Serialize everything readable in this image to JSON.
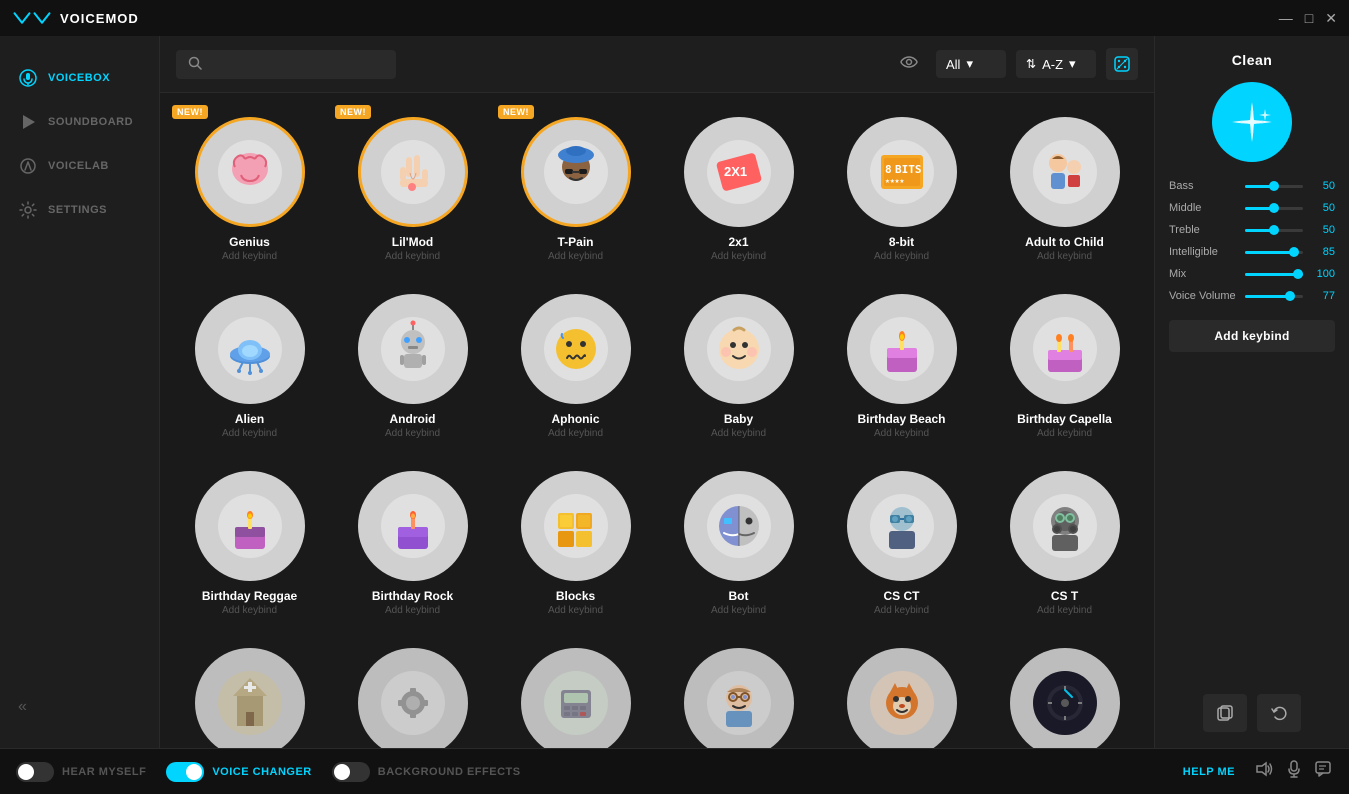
{
  "app": {
    "title": "VOICEMOD",
    "logo_unicode": "〜"
  },
  "title_bar": {
    "minimize": "—",
    "maximize": "□",
    "close": "✕"
  },
  "sidebar": {
    "items": [
      {
        "id": "voicebox",
        "label": "VOICEBOX",
        "icon": "🎤",
        "active": true
      },
      {
        "id": "soundboard",
        "label": "SOUNDBOARD",
        "icon": "⚡"
      },
      {
        "id": "voicelab",
        "label": "VOICELAB",
        "icon": "🎙"
      },
      {
        "id": "settings",
        "label": "SETTINGS",
        "icon": "⚙"
      }
    ],
    "collapse_icon": "«"
  },
  "toolbar": {
    "search_placeholder": "",
    "search_icon": "🔍",
    "eye_icon": "👁",
    "filter_label": "All",
    "filter_chevron": "▾",
    "sort_icon": "⇅",
    "sort_label": "A-Z",
    "sort_chevron": "▾",
    "dice_icon": "⚄"
  },
  "voices": [
    {
      "id": "genius",
      "name": "Genius",
      "keybind": "Add keybind",
      "badge": "NEW!",
      "emoji": "🧠",
      "bg": "#d8d8d8",
      "highlighted": true
    },
    {
      "id": "lilmod",
      "name": "Lil'Mod",
      "keybind": "Add keybind",
      "badge": "NEW!",
      "emoji": "✌️",
      "bg": "#d8d8d8",
      "highlighted": true
    },
    {
      "id": "tpain",
      "name": "T-Pain",
      "keybind": "Add keybind",
      "badge": "NEW!",
      "emoji": "🎤",
      "bg": "#d8d8d8",
      "highlighted": true
    },
    {
      "id": "2x1",
      "name": "2x1",
      "keybind": "Add keybind",
      "badge": "",
      "emoji": "🏷",
      "bg": "#d8d8d8",
      "highlighted": false
    },
    {
      "id": "8bit",
      "name": "8-bit",
      "keybind": "Add keybind",
      "badge": "",
      "emoji": "8️⃣",
      "bg": "#d8d8d8",
      "highlighted": false
    },
    {
      "id": "adult-to-child",
      "name": "Adult to Child",
      "keybind": "Add keybind",
      "badge": "",
      "emoji": "👨‍👧",
      "bg": "#d8d8d8",
      "highlighted": false
    },
    {
      "id": "alien",
      "name": "Alien",
      "keybind": "Add keybind",
      "badge": "",
      "emoji": "🛸",
      "bg": "#d8d8d8",
      "highlighted": false
    },
    {
      "id": "android",
      "name": "Android",
      "keybind": "Add keybind",
      "badge": "",
      "emoji": "🤖",
      "bg": "#d8d8d8",
      "highlighted": false
    },
    {
      "id": "aphonic",
      "name": "Aphonic",
      "keybind": "Add keybind",
      "badge": "",
      "emoji": "😖",
      "bg": "#d8d8d8",
      "highlighted": false
    },
    {
      "id": "baby",
      "name": "Baby",
      "keybind": "Add keybind",
      "badge": "",
      "emoji": "👶",
      "bg": "#d8d8d8",
      "highlighted": false
    },
    {
      "id": "birthday-beach",
      "name": "Birthday Beach",
      "keybind": "Add keybind",
      "badge": "",
      "emoji": "🎂",
      "bg": "#d8d8d8",
      "highlighted": false
    },
    {
      "id": "birthday-capella",
      "name": "Birthday Capella",
      "keybind": "Add keybind",
      "badge": "",
      "emoji": "🕯",
      "bg": "#d8d8d8",
      "highlighted": false
    },
    {
      "id": "birthday-reggae",
      "name": "Birthday Reggae",
      "keybind": "Add keybind",
      "badge": "",
      "emoji": "🎂",
      "bg": "#d8d8d8",
      "highlighted": false
    },
    {
      "id": "birthday-rock",
      "name": "Birthday Rock",
      "keybind": "Add keybind",
      "badge": "",
      "emoji": "🎂",
      "bg": "#d8d8d8",
      "highlighted": false
    },
    {
      "id": "blocks",
      "name": "Blocks",
      "keybind": "Add keybind",
      "badge": "",
      "emoji": "🟨",
      "bg": "#d8d8d8",
      "highlighted": false
    },
    {
      "id": "bot",
      "name": "Bot",
      "keybind": "Add keybind",
      "badge": "",
      "emoji": "🤖",
      "bg": "#d8d8d8",
      "highlighted": false
    },
    {
      "id": "cs-ct",
      "name": "CS CT",
      "keybind": "Add keybind",
      "badge": "",
      "emoji": "🥽",
      "bg": "#d8d8d8",
      "highlighted": false
    },
    {
      "id": "cs-t",
      "name": "CS T",
      "keybind": "Add keybind",
      "badge": "",
      "emoji": "😷",
      "bg": "#d8d8d8",
      "highlighted": false
    },
    {
      "id": "v19",
      "name": "",
      "keybind": "",
      "badge": "",
      "emoji": "🏛",
      "bg": "#d8d8d8",
      "highlighted": false,
      "partial": true
    },
    {
      "id": "v20",
      "name": "",
      "keybind": "",
      "badge": "",
      "emoji": "⚙",
      "bg": "#d8d8d8",
      "highlighted": false,
      "partial": true
    },
    {
      "id": "v21",
      "name": "",
      "keybind": "",
      "badge": "",
      "emoji": "📟",
      "bg": "#d8d8d8",
      "highlighted": false,
      "partial": true
    },
    {
      "id": "v22",
      "name": "",
      "keybind": "",
      "badge": "",
      "emoji": "👓",
      "bg": "#d8d8d8",
      "highlighted": false,
      "partial": true
    },
    {
      "id": "v23",
      "name": "",
      "keybind": "",
      "badge": "",
      "emoji": "🦊",
      "bg": "#d8d8d8",
      "highlighted": false,
      "partial": true
    },
    {
      "id": "v24",
      "name": "",
      "keybind": "",
      "badge": "",
      "emoji": "🎛",
      "bg": "#d8d8d8",
      "highlighted": false,
      "partial": true
    }
  ],
  "right_panel": {
    "title": "Clean",
    "avatar_emoji": "✨",
    "avatar_bg": "#00d4ff",
    "sliders": [
      {
        "id": "bass",
        "label": "Bass",
        "value": 50,
        "percent": 50
      },
      {
        "id": "middle",
        "label": "Middle",
        "value": 50,
        "percent": 50
      },
      {
        "id": "treble",
        "label": "Treble",
        "value": 50,
        "percent": 50
      },
      {
        "id": "intelligible",
        "label": "Intelligible",
        "value": 85,
        "percent": 85
      },
      {
        "id": "mix",
        "label": "Mix",
        "value": 100,
        "percent": 100
      },
      {
        "id": "voice-volume",
        "label": "Voice Volume",
        "value": 77,
        "percent": 77
      }
    ],
    "add_keybind_label": "Add keybind",
    "copy_icon": "⧉",
    "undo_icon": "↺"
  },
  "bottom_bar": {
    "hear_myself_label": "HEAR MYSELF",
    "hear_myself_on": false,
    "voice_changer_label": "VOICE CHANGER",
    "voice_changer_on": true,
    "background_effects_label": "BACKGROUND EFFECTS",
    "background_effects_on": false,
    "help_label": "HELP ME",
    "speaker_icon": "🔊",
    "mic_icon": "🎤",
    "chat_icon": "💬"
  },
  "colors": {
    "accent": "#00d4ff",
    "orange": "#f5a623",
    "bg_dark": "#1a1a1a",
    "bg_medium": "#1e1e1e",
    "bg_light": "#2a2a2a"
  }
}
